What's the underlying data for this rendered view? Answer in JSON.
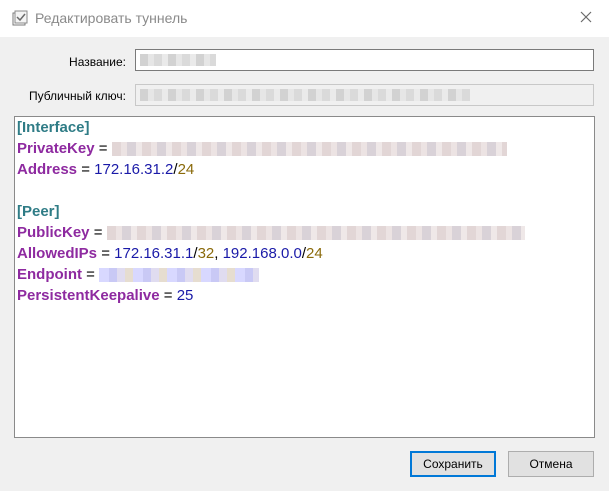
{
  "window": {
    "title": "Редактировать туннель",
    "app_icon": "tunnel-config-icon",
    "close_icon": "close-icon"
  },
  "form": {
    "name_label": "Название:",
    "public_key_label": "Публичный ключ:"
  },
  "editor": {
    "interface_header": "[Interface]",
    "private_key_key": "PrivateKey",
    "address_key": "Address",
    "address_ip": "172.16.31.2",
    "address_cidr": "24",
    "peer_header": "[Peer]",
    "public_key_key": "PublicKey",
    "allowed_ips_key": "AllowedIPs",
    "allowed_ip_1": "172.16.31.1",
    "allowed_cidr_1": "32",
    "allowed_ip_2": "192.168.0.0",
    "allowed_cidr_2": "24",
    "endpoint_key": "Endpoint",
    "keepalive_key": "PersistentKeepalive",
    "keepalive_value": "25",
    "equals": "=",
    "slash": "/",
    "comma": ","
  },
  "buttons": {
    "save": "Сохранить",
    "cancel": "Отмена"
  },
  "colors": {
    "section": "#2f7c86",
    "key": "#8e2aa0",
    "ip": "#1a1aa8",
    "cidr": "#8a6a0a",
    "accent": "#0078d7"
  }
}
